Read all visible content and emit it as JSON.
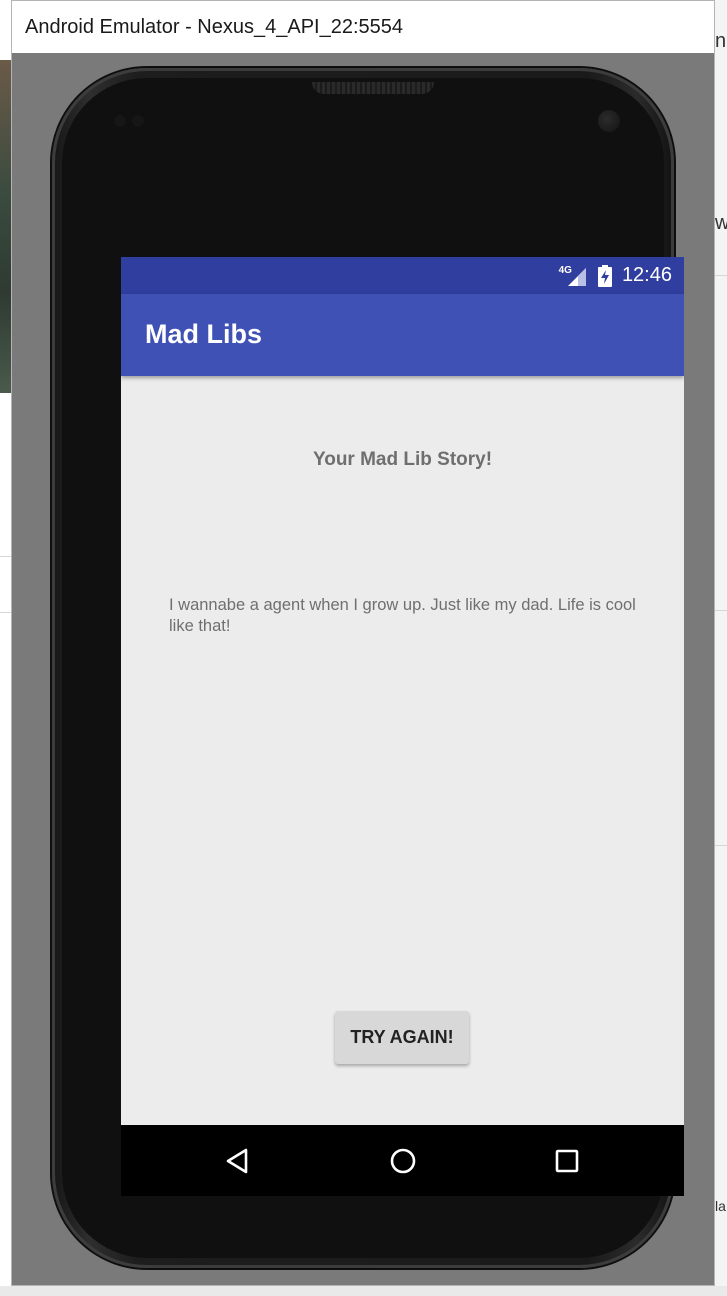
{
  "window": {
    "title": "Android Emulator - Nexus_4_API_22:5554"
  },
  "status_bar": {
    "network": "4G",
    "time": "12:46",
    "icons": [
      "signal-icon",
      "battery-charging-icon"
    ]
  },
  "app_bar": {
    "title": "Mad Libs"
  },
  "content": {
    "heading": "Your Mad Lib Story!",
    "story": "I wannabe a agent when I grow up. Just like my dad. Life is cool like that!",
    "button_label": "TRY AGAIN!"
  },
  "nav_bar": {
    "icons": [
      "back-icon",
      "home-icon",
      "recents-icon"
    ]
  },
  "background": {
    "right_edge_text_1": "nc",
    "right_edge_text_2": "w",
    "right_edge_text_3": "la"
  },
  "colors": {
    "status_bar": "#303f9f",
    "app_bar": "#3f51b5",
    "screen_background": "#ececec",
    "button": "#d8d8d8"
  }
}
